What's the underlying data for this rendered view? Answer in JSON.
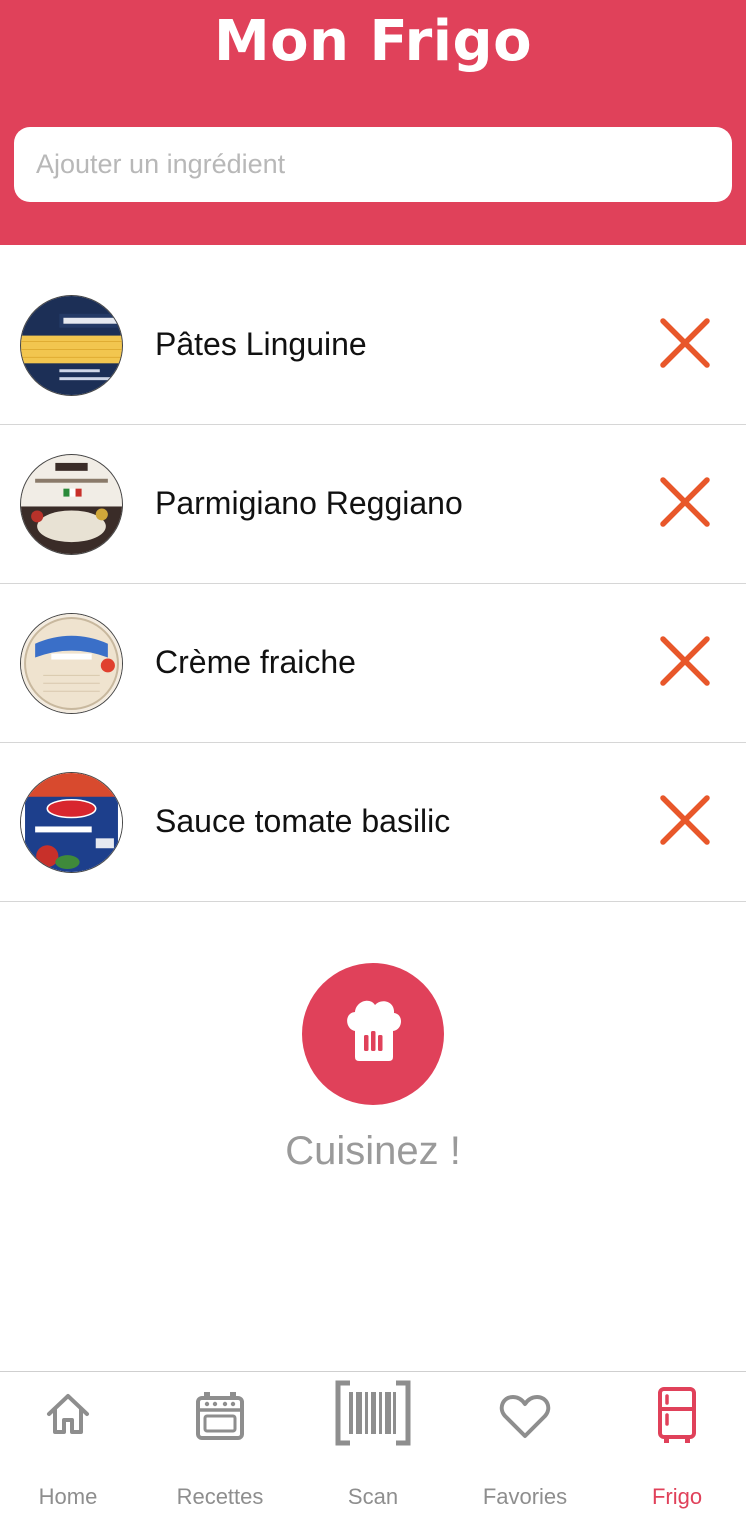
{
  "header": {
    "title": "Mon Frigo",
    "search_placeholder": "Ajouter un ingrédient",
    "background_color": "#e0415a"
  },
  "ingredients": [
    {
      "name": "Pâtes Linguine",
      "image": "linguine-pack-image"
    },
    {
      "name": "Parmigiano Reggiano",
      "image": "parmesan-pack-image"
    },
    {
      "name": "Crème fraiche",
      "image": "creme-fraiche-pot-image"
    },
    {
      "name": "Sauce tomate basilic",
      "image": "barilla-basilico-jar-image"
    }
  ],
  "remove_icon": "close-icon",
  "remove_icon_color": "#e8572a",
  "cook": {
    "icon": "chef-hat-icon",
    "label": "Cuisinez !"
  },
  "tabbar": {
    "active": "Frigo",
    "active_color": "#e0415a",
    "items": [
      {
        "label": "Home",
        "icon": "home-icon"
      },
      {
        "label": "Recettes",
        "icon": "oven-icon"
      },
      {
        "label": "Scan",
        "icon": "barcode-icon"
      },
      {
        "label": "Favories",
        "icon": "heart-icon"
      },
      {
        "label": "Frigo",
        "icon": "fridge-icon"
      }
    ]
  }
}
